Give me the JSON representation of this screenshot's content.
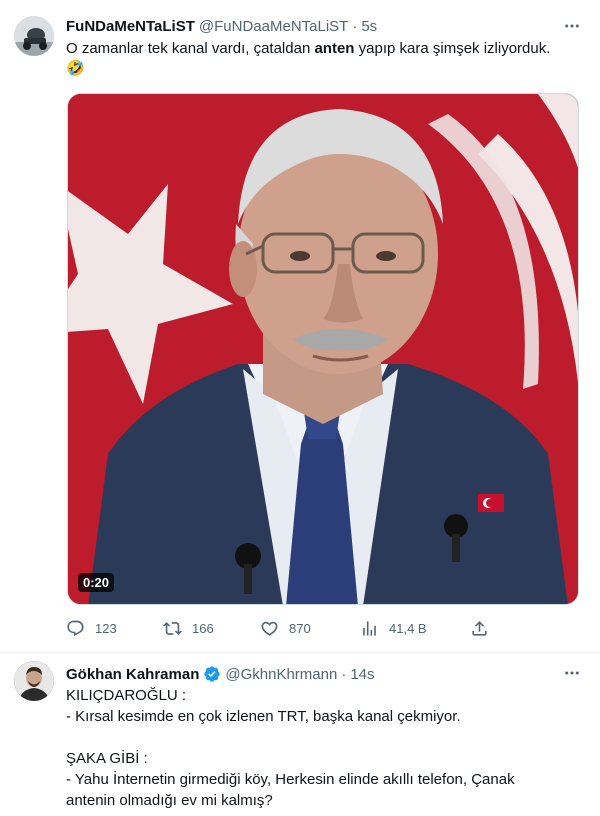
{
  "tweets": [
    {
      "author": {
        "name": "FuNDaMeNTaLiST",
        "handle": "@FuNDaaMeNTaLiST",
        "avatar_icon": "user-avatar"
      },
      "separator": "·",
      "time": "5s",
      "text": {
        "before": "O zamanlar tek kanal vardı, çataldan ",
        "bold": "anten",
        "after": " yapıp kara şimşek izliyorduk.",
        "emoji": "🤣"
      },
      "media": {
        "type": "video",
        "duration": "0:20",
        "description_icon": "video-thumbnail"
      },
      "actions": {
        "replies": "123",
        "retweets": "166",
        "likes": "870",
        "views": "41,4 B"
      }
    },
    {
      "author": {
        "name": "Gökhan Kahraman",
        "handle": "@GkhnKhrmann",
        "verified": true,
        "avatar_icon": "user-avatar"
      },
      "separator": "·",
      "time": "14s",
      "lines": [
        "KILIÇDAROĞLU :",
        "- Kırsal kesimde en çok izlenen TRT, başka kanal çekmiyor.",
        "",
        "ŞAKA GİBİ :",
        "- Yahu İnternetin girmediği köy, Herkesin elinde akıllı telefon, Çanak",
        "antenin olmadığı ev mi kalmış?"
      ]
    }
  ],
  "colors": {
    "text": "#0f1419",
    "secondary": "#536471",
    "verified": "#1d9bf0",
    "border": "#eff3f4",
    "flag_red": "#c8102e"
  }
}
